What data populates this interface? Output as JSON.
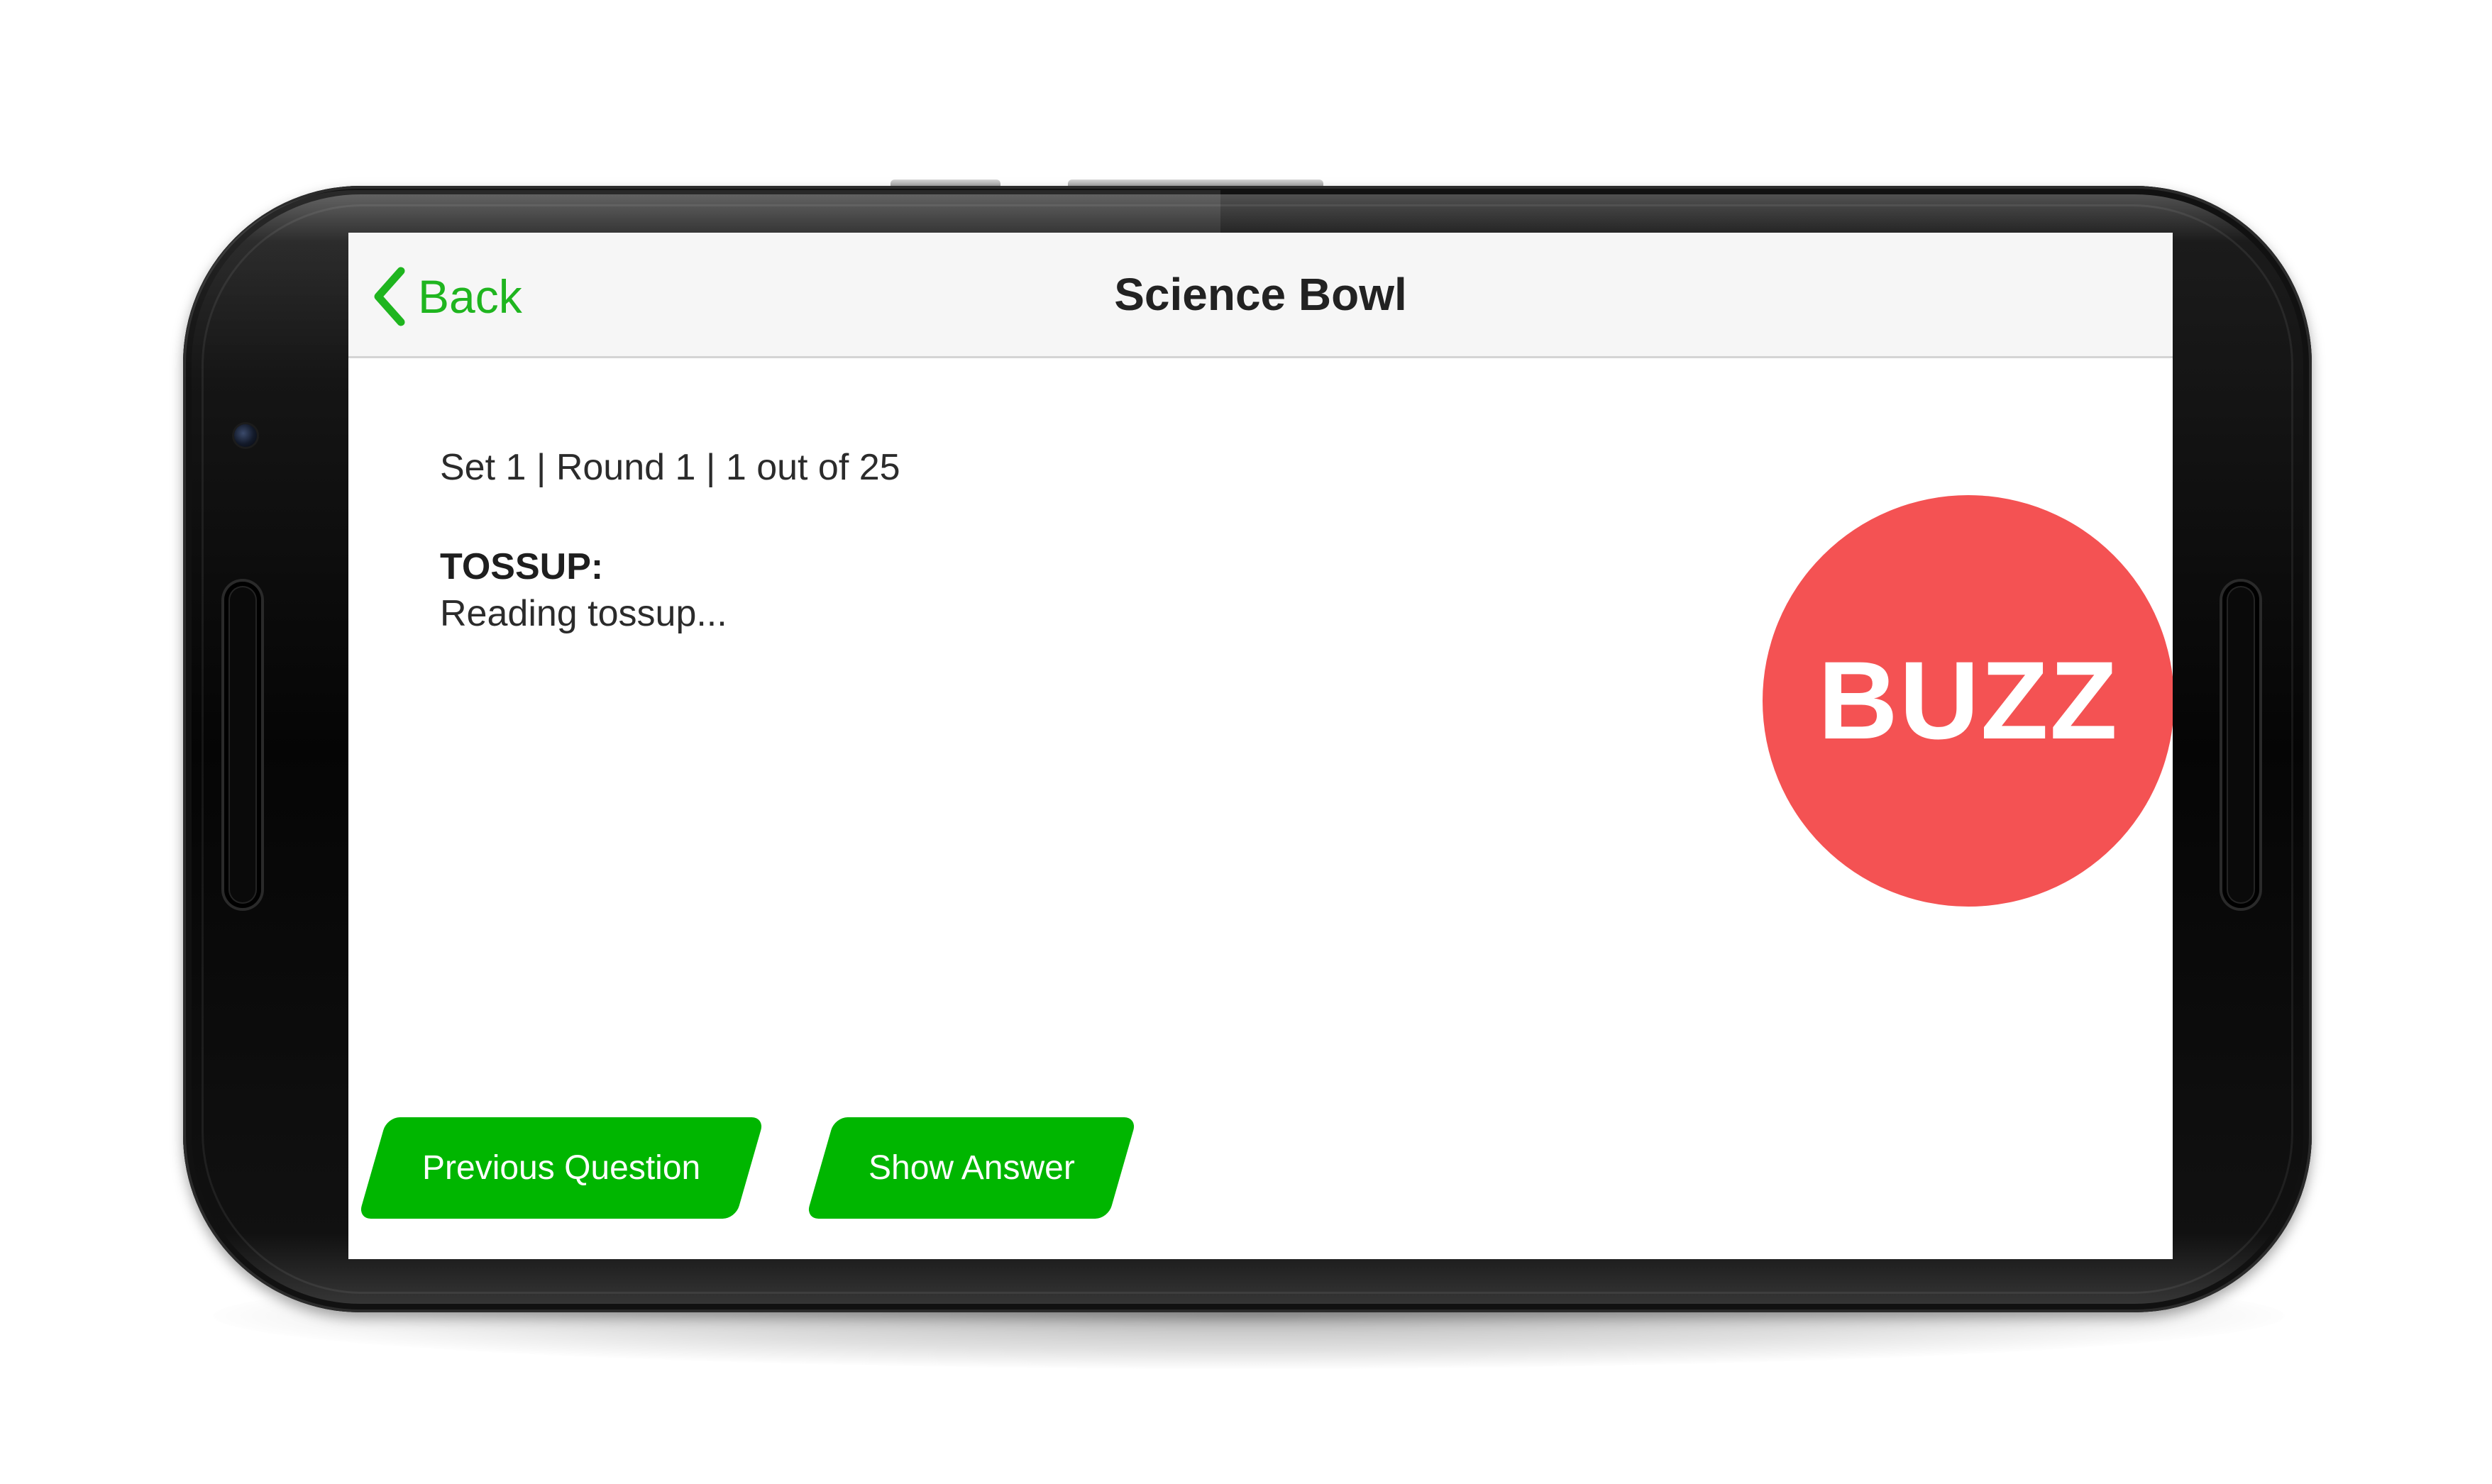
{
  "navbar": {
    "back_label": "Back",
    "title": "Science Bowl"
  },
  "question": {
    "meta": "Set 1 | Round 1 | 1 out of 25",
    "type_heading": "TOSSUP:",
    "body": "Reading tossup..."
  },
  "buzz": {
    "label": "BUZZ"
  },
  "actions": {
    "previous_label": "Previous Question",
    "show_answer_label": "Show Answer"
  },
  "colors": {
    "accent_green": "#00b600",
    "back_green": "#1fb51f",
    "buzz_red": "#f45253"
  },
  "icons": {
    "back": "chevron-left-icon"
  }
}
